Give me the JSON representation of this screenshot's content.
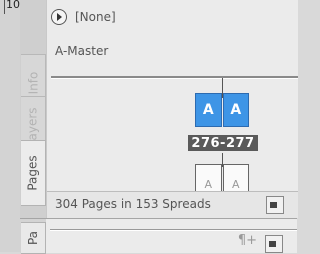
{
  "ruler": {
    "number": "10"
  },
  "tabs": {
    "info": "Info",
    "layers": "ayers",
    "pages": "Pages",
    "bottom": "Pa"
  },
  "pages_panel": {
    "none_label": "[None]",
    "master_label": "A-Master",
    "spread_pages": [
      "A",
      "A"
    ],
    "spread_label": "276-277",
    "next_spread_pages": [
      "A",
      "A"
    ],
    "status": "304 Pages in 153 Spreads"
  },
  "bottom_panel": {
    "symbol": "¶+"
  }
}
